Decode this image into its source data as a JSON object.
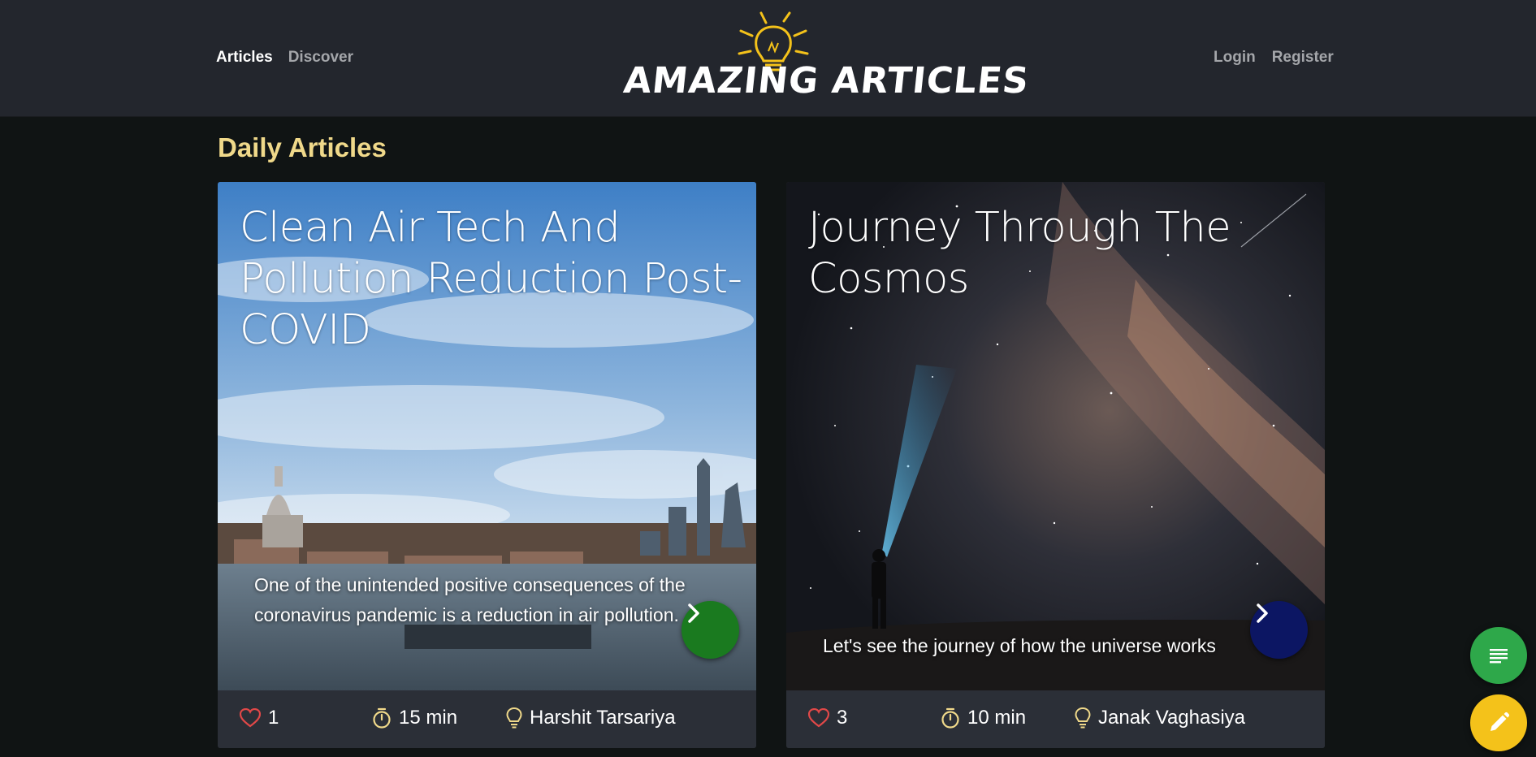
{
  "nav": {
    "left": [
      {
        "label": "Articles",
        "active": true
      },
      {
        "label": "Discover",
        "active": false
      }
    ],
    "right": [
      {
        "label": "Login"
      },
      {
        "label": "Register"
      }
    ],
    "brand": "AMAZING ARTICLES"
  },
  "section_title": "Daily Articles",
  "articles": [
    {
      "title": "Clean Air Tech And Pollution Reduction Post-COVID",
      "description": "One of the unintended positive consequences of the coronavirus pandemic is a reduction in air pollution.",
      "likes": "1",
      "read_time": "15 min",
      "author": "Harshit Tarsariya",
      "button_color": "#1a7a1f"
    },
    {
      "title": "Journey Through The Cosmos",
      "description": "Let's see the journey of how the universe works",
      "likes": "3",
      "read_time": "10 min",
      "author": "Janak Vaghasiya",
      "button_color": "#0c1663"
    }
  ],
  "icons": {
    "likes": "heart-icon",
    "read_time": "stopwatch-icon",
    "author": "lightbulb-icon",
    "next": "chevron-right-icon",
    "fab_list": "list-icon",
    "fab_edit": "pencil-icon"
  },
  "colors": {
    "header_bg": "#23262d",
    "page_bg": "#101414",
    "section_title": "#f0d98a",
    "heart": "#e04848",
    "meta_icon": "#f0d98a",
    "fab_list": "#2ea84a",
    "fab_edit": "#f4c21a"
  }
}
